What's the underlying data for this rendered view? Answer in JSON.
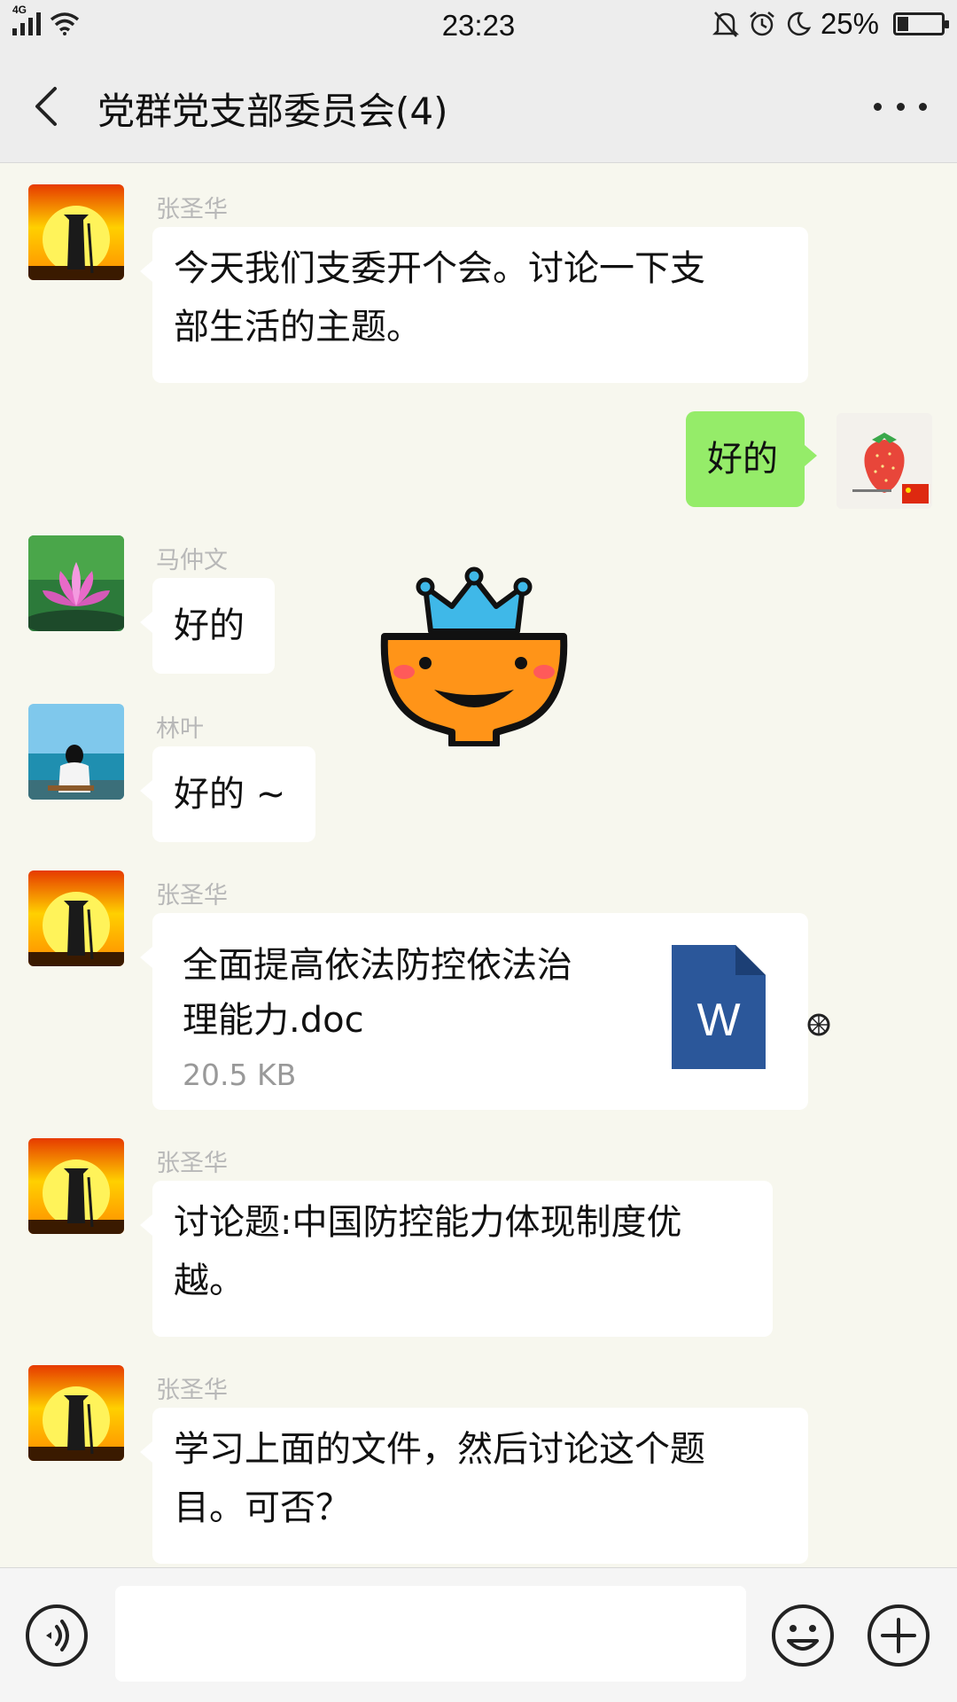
{
  "status_bar": {
    "network": "4G",
    "time": "23:23",
    "battery": "25%",
    "battery_level": 0.25,
    "icons": [
      "signal-icon",
      "wifi-icon",
      "mute-bell-icon",
      "alarm-icon",
      "moon-icon",
      "battery-icon"
    ]
  },
  "header": {
    "title": "党群党支部委员会(4)",
    "back_icon": "chevron-left-icon",
    "more_icon": "more-icon"
  },
  "messages": [
    {
      "sender": "张圣华",
      "text": "今天我们支委开个会。讨论一下支部生活的主题。",
      "lines": [
        "今天我们支委开个会。讨论一下支",
        "部生活的主题。"
      ]
    },
    {
      "sender": "",
      "text": "好的",
      "self": true
    },
    {
      "sender": "马仲文",
      "text": "好的"
    },
    {
      "sender": "林叶",
      "text": "好的 ~"
    },
    {
      "sender": "张圣华",
      "file": {
        "name_lines": [
          "全面提高依法防控依法治",
          "理能力.doc"
        ],
        "size": "20.5 KB",
        "icon_letter": "W"
      }
    },
    {
      "sender": "张圣华",
      "text": "讨论题:中国防控能力体现制度优越。",
      "lines": [
        "讨论题:中国防控能力体现制度优",
        "越。"
      ]
    },
    {
      "sender": "张圣华",
      "text": "学习上面的文件，然后讨论这个题目。可否？",
      "lines": [
        "学习上面的文件，然后讨论这个题",
        "目。可否？"
      ]
    }
  ],
  "input_bar": {
    "voice_icon": "voice-icon",
    "emoji_icon": "emoji-icon",
    "plus_icon": "plus-icon",
    "input_value": ""
  },
  "colors": {
    "chat_bg": "#f7f7ee",
    "self_bubble": "#95ec69",
    "doc_icon": "#2b579a"
  }
}
